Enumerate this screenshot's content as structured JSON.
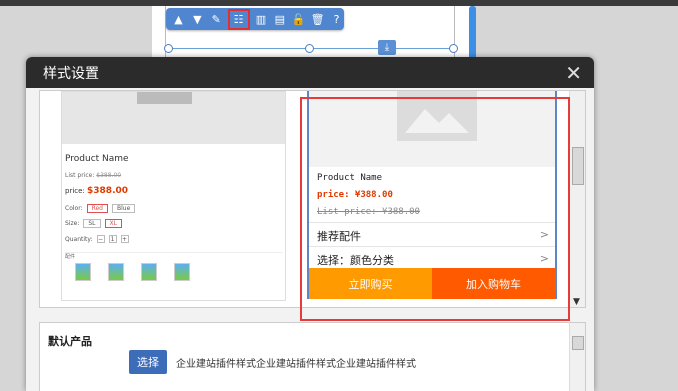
{
  "dialog": {
    "title": "样式设置",
    "close_icon": "close-icon"
  },
  "toolbar": {
    "icons": [
      "chevron-up-icon",
      "chevron-down-icon",
      "edit-icon",
      "list-layout-icon",
      "chart-icon",
      "chart-alt-icon",
      "unlock-icon",
      "trash-icon",
      "help-icon"
    ],
    "glyphs": [
      "▲",
      "▼",
      "✎",
      "☷",
      "▥",
      "▤",
      "🔓",
      "🗑",
      "?"
    ],
    "active_index": 3
  },
  "mini_preview": {
    "product_name": "Product Name",
    "list_price_label": "List price:",
    "list_price": "$388.00",
    "price_label": "price:",
    "price": "$388.00",
    "color_label": "Color:",
    "colors": [
      "Red",
      "Blue"
    ],
    "size_label": "Size:",
    "sizes": [
      "SL",
      "XL"
    ],
    "quantity_label": "Quantity:",
    "quantity": "1",
    "accessory_label": "配件"
  },
  "right_preview": {
    "product_name": "Product Name",
    "price": "price: ¥388.00",
    "list_price": "List price: ¥388.00",
    "recommended": "推荐配件",
    "choose_option": "选择：颜色分类",
    "buy_now": "立即购买",
    "add_to_cart": "加入购物车"
  },
  "settings": {
    "label": "默认产品",
    "choose_button": "选择",
    "description": "企业建站插件样式企业建站插件样式企业建站插件样式"
  },
  "colors": {
    "accent": "#3d6cb9",
    "highlight": "#e53b3b",
    "buy": "#ff9a00",
    "cart": "#ff5a00"
  }
}
